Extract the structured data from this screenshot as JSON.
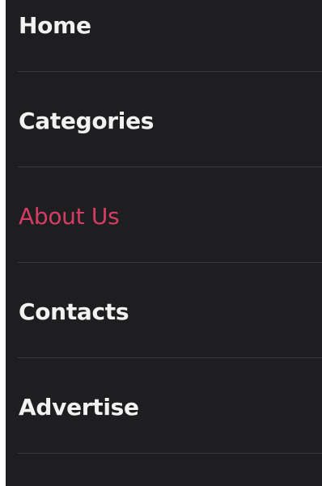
{
  "colors": {
    "panel_background": "#1e1e20",
    "text": "#f2f2f2",
    "active_text": "#d63d64",
    "divider": "#3a3a3c"
  },
  "nav": {
    "items": [
      {
        "label": "Home",
        "active": false
      },
      {
        "label": "Categories",
        "active": false
      },
      {
        "label": "About Us",
        "active": true
      },
      {
        "label": "Contacts",
        "active": false
      },
      {
        "label": "Advertise",
        "active": false
      }
    ]
  }
}
